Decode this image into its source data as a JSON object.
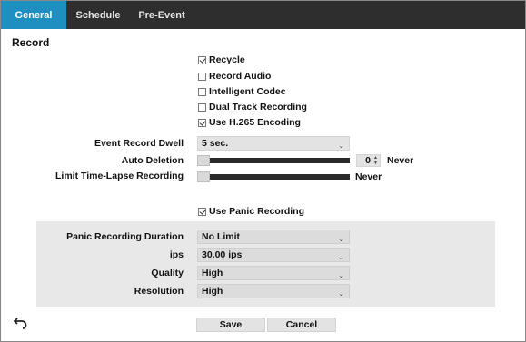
{
  "tabs": [
    {
      "label": "General",
      "active": true
    },
    {
      "label": "Schedule",
      "active": false
    },
    {
      "label": "Pre-Event",
      "active": false
    }
  ],
  "section_title": "Record",
  "checkboxes": {
    "recycle": {
      "label": "Recycle",
      "checked": true
    },
    "record_audio": {
      "label": "Record Audio",
      "checked": false
    },
    "intelligent_codec": {
      "label": "Intelligent Codec",
      "checked": false
    },
    "dual_track": {
      "label": "Dual Track Recording",
      "checked": false
    },
    "h265": {
      "label": "Use H.265 Encoding",
      "checked": true
    },
    "panic": {
      "label": "Use Panic Recording",
      "checked": true
    }
  },
  "event_record_dwell": {
    "label": "Event Record Dwell",
    "value": "5 sec."
  },
  "auto_deletion": {
    "label": "Auto Deletion",
    "value": "0",
    "unit": "Never"
  },
  "limit_time_lapse": {
    "label": "Limit Time-Lapse Recording",
    "unit": "Never"
  },
  "panic_settings": {
    "duration": {
      "label": "Panic Recording Duration",
      "value": "No Limit"
    },
    "ips": {
      "label": "ips",
      "value": "30.00 ips"
    },
    "quality": {
      "label": "Quality",
      "value": "High"
    },
    "resolution": {
      "label": "Resolution",
      "value": "High"
    }
  },
  "icons": {
    "back": "undo-arrow-icon",
    "dropdown": "chevron-down-icon"
  },
  "buttons": {
    "save": "Save",
    "cancel": "Cancel"
  },
  "colors": {
    "active_tab": "#1e8fc0",
    "tab_bar": "#2e2e2e",
    "panel": "#e8e8e8"
  }
}
